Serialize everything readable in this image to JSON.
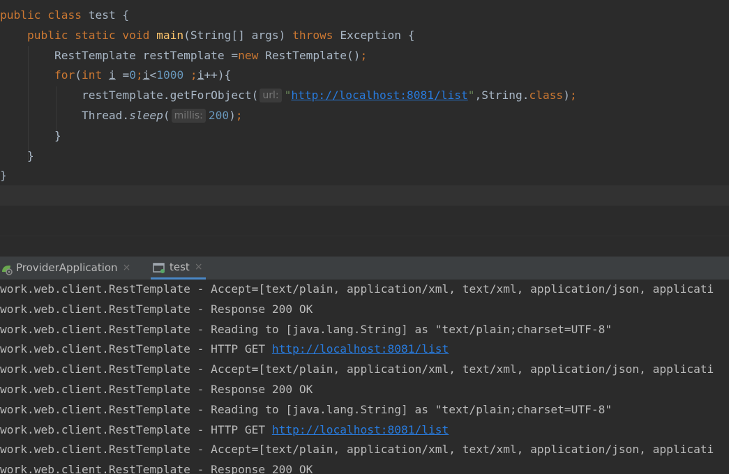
{
  "editor": {
    "lines": [
      {
        "segments": [
          {
            "t": "public class ",
            "c": "kw"
          },
          {
            "t": "test {",
            "c": ""
          }
        ]
      },
      {
        "indent": "    ",
        "segments": [
          {
            "t": "public static void ",
            "c": "kw"
          },
          {
            "t": "main",
            "c": "fn"
          },
          {
            "t": "(String[] args) ",
            "c": ""
          },
          {
            "t": "throws ",
            "c": "kw"
          },
          {
            "t": "Exception {",
            "c": ""
          }
        ]
      },
      {
        "indent": "        ",
        "segments": [
          {
            "t": "RestTemplate restTemplate =",
            "c": ""
          },
          {
            "t": "new ",
            "c": "kw"
          },
          {
            "t": "RestTemplate()",
            "c": ""
          },
          {
            "t": ";",
            "c": "kw"
          }
        ]
      },
      {
        "indent": "        ",
        "segments": [
          {
            "t": "for",
            "c": "kw"
          },
          {
            "t": "(",
            "c": ""
          },
          {
            "t": "int ",
            "c": "kw"
          },
          {
            "t": "i",
            "c": "under"
          },
          {
            "t": " =",
            "c": ""
          },
          {
            "t": "0",
            "c": "num"
          },
          {
            "t": ";",
            "c": "kw"
          },
          {
            "t": "i",
            "c": "under"
          },
          {
            "t": "<",
            "c": ""
          },
          {
            "t": "1000",
            "c": "num"
          },
          {
            "t": " ;",
            "c": "kw"
          },
          {
            "t": "i",
            "c": "under"
          },
          {
            "t": "++){",
            "c": ""
          }
        ]
      },
      {
        "indent": "            ",
        "segments": [
          {
            "t": "restTemplate.getForObject(",
            "c": ""
          },
          {
            "hint": "url:"
          },
          {
            "t": "\"",
            "c": "str"
          },
          {
            "t": "http://localhost:8081/list",
            "c": "link"
          },
          {
            "t": "\"",
            "c": "str"
          },
          {
            "t": ",String.",
            "c": ""
          },
          {
            "t": "class",
            "c": "kw"
          },
          {
            "t": ")",
            "c": ""
          },
          {
            "t": ";",
            "c": "kw"
          }
        ]
      },
      {
        "indent": "            ",
        "segments": [
          {
            "t": "Thread.",
            "c": ""
          },
          {
            "t": "sleep",
            "c": "static-italic"
          },
          {
            "t": "(",
            "c": ""
          },
          {
            "hint": "millis:"
          },
          {
            "t": "200",
            "c": "num"
          },
          {
            "t": ")",
            "c": ""
          },
          {
            "t": ";",
            "c": "kw"
          }
        ]
      },
      {
        "indent": "        ",
        "segments": [
          {
            "t": "}",
            "c": ""
          }
        ]
      },
      {
        "indent": "    ",
        "segments": [
          {
            "t": "}",
            "c": ""
          }
        ]
      },
      {
        "segments": [
          {
            "t": "}",
            "c": ""
          }
        ]
      }
    ]
  },
  "tabs": [
    {
      "label": "ProviderApplication",
      "icon": "spring-boot-icon",
      "close": "×",
      "active": false
    },
    {
      "label": "test",
      "icon": "run-config-icon",
      "close": "×",
      "active": true
    }
  ],
  "console": {
    "lines": [
      {
        "prefix": "work.web.client.RestTemplate - ",
        "text": "Accept=[text/plain, application/xml, text/xml, application/json, applicati"
      },
      {
        "prefix": "work.web.client.RestTemplate - ",
        "text": "Response 200 OK"
      },
      {
        "prefix": "work.web.client.RestTemplate - ",
        "text": "Reading to [java.lang.String] as \"text/plain;charset=UTF-8\""
      },
      {
        "prefix": "work.web.client.RestTemplate - ",
        "text": "HTTP GET ",
        "link": "http://localhost:8081/list"
      },
      {
        "prefix": "work.web.client.RestTemplate - ",
        "text": "Accept=[text/plain, application/xml, text/xml, application/json, applicati"
      },
      {
        "prefix": "work.web.client.RestTemplate - ",
        "text": "Response 200 OK"
      },
      {
        "prefix": "work.web.client.RestTemplate - ",
        "text": "Reading to [java.lang.String] as \"text/plain;charset=UTF-8\""
      },
      {
        "prefix": "work.web.client.RestTemplate - ",
        "text": "HTTP GET ",
        "link": "http://localhost:8081/list"
      },
      {
        "prefix": "work.web.client.RestTemplate - ",
        "text": "Accept=[text/plain, application/xml, text/xml, application/json, applicati"
      },
      {
        "prefix": "work.web.client.RestTemplate - ",
        "text": "Response 200 OK"
      }
    ]
  },
  "colors": {
    "editor_bg": "#2b2b2b",
    "keyword": "#cc7832",
    "method": "#ffc66d",
    "number": "#6897bb",
    "string": "#6a8759",
    "link": "#287bde",
    "text": "#a9b7c6"
  }
}
